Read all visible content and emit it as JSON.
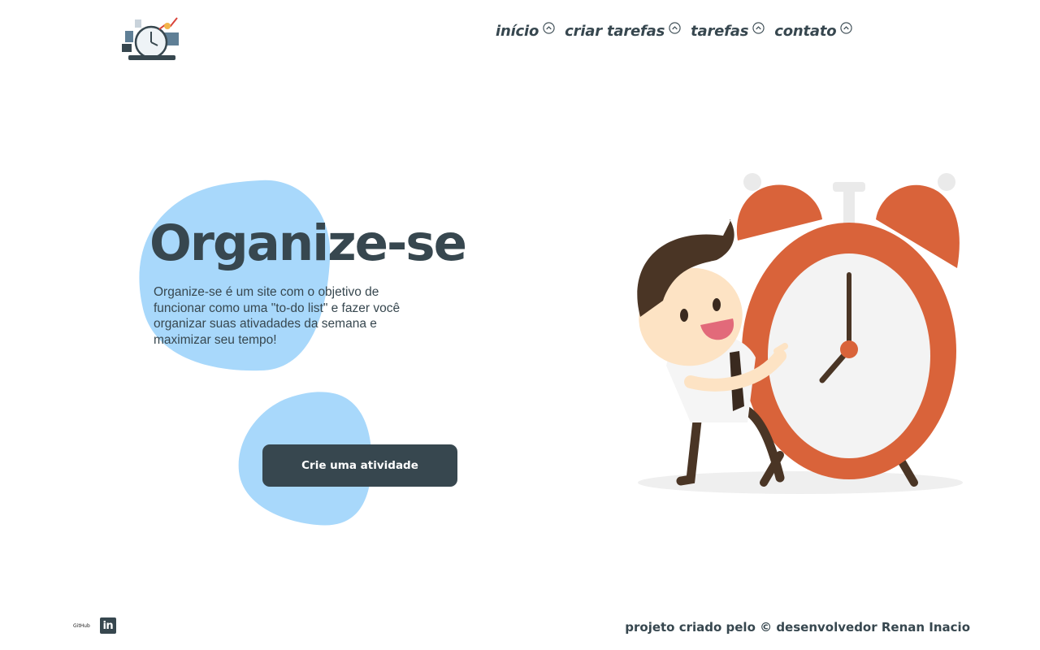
{
  "header": {
    "logo_icon": "clock-logo-icon",
    "nav": [
      {
        "label": "início",
        "icon": "chevron-up-circle-icon"
      },
      {
        "label": "criar tarefas",
        "icon": "chevron-up-circle-icon"
      },
      {
        "label": "tarefas",
        "icon": "chevron-up-circle-icon"
      },
      {
        "label": "contato",
        "icon": "chevron-up-circle-icon"
      }
    ]
  },
  "hero": {
    "title": "Organize-se",
    "description": "Organize-se é um site com o objetivo de funcionar como uma \"to-do list\" e fazer você organizar suas ativadades da semana e maximizar seu tempo!",
    "cta_label": "Crie uma atividade",
    "illustration": "man-with-alarm-clock-illustration"
  },
  "footer": {
    "github_label": "GitHub",
    "linkedin_label": "in",
    "credit": "projeto criado pelo © desenvolvedor Renan Inacio"
  },
  "colors": {
    "primary": "#37474f",
    "blob": "#a8d8fb",
    "clock_orange": "#d9633a",
    "background": "#ffffff"
  }
}
